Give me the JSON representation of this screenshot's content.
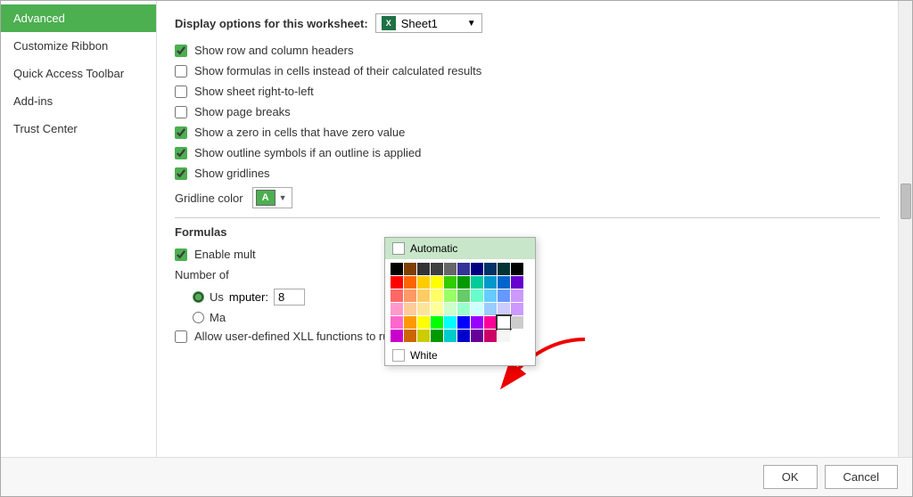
{
  "sidebar": {
    "items": [
      {
        "id": "advanced",
        "label": "Advanced",
        "active": true
      },
      {
        "id": "customize-ribbon",
        "label": "Customize Ribbon",
        "active": false
      },
      {
        "id": "quick-access-toolbar",
        "label": "Quick Access Toolbar",
        "active": false
      },
      {
        "id": "add-ins",
        "label": "Add-ins",
        "active": false
      },
      {
        "id": "trust-center",
        "label": "Trust Center",
        "active": false
      }
    ]
  },
  "main": {
    "display_section_label": "Display options for this worksheet:",
    "sheet_name": "Sheet1",
    "checkboxes": [
      {
        "id": "row-col-headers",
        "label": "Show row and column headers",
        "checked": true
      },
      {
        "id": "formulas-cells",
        "label": "Show formulas in cells instead of their calculated results",
        "checked": false
      },
      {
        "id": "sheet-right-to-left",
        "label": "Show sheet right-to-left",
        "checked": false
      },
      {
        "id": "page-breaks",
        "label": "Show page breaks",
        "checked": false
      },
      {
        "id": "zero-cells",
        "label": "Show a zero in cells that have zero value",
        "checked": true
      },
      {
        "id": "outline-symbols",
        "label": "Show outline symbols if an outline is applied",
        "checked": true
      },
      {
        "id": "gridlines",
        "label": "Show gridlines",
        "checked": true
      }
    ],
    "gridline_color_label": "Gridline color",
    "formulas": {
      "title": "Formulas",
      "enable_multi_label": "Enable mult",
      "enable_multi_checked": true,
      "number_of_label": "Number of",
      "radio_options": [
        {
          "id": "use-computer",
          "label": "Us",
          "detail": "mputer:",
          "value": "8",
          "selected": true
        },
        {
          "id": "manual",
          "label": "Ma",
          "selected": false
        }
      ],
      "allow_xll_label": "Allow user-defined XLL functions to run on a compute cluster",
      "allow_xll_checked": false
    }
  },
  "color_picker": {
    "automatic_label": "Automatic",
    "white_label": "White",
    "colors": [
      [
        "#000000",
        "#7f3f00",
        "#333333",
        "#3f3f3f",
        "#666666",
        "#333399",
        "#000080",
        "#003366",
        "#003333",
        "#000000"
      ],
      [
        "#ff0000",
        "#ff6600",
        "#ffcc00",
        "#ffff00",
        "#33cc00",
        "#009900",
        "#00cc99",
        "#0099cc",
        "#0066cc",
        "#6600cc"
      ],
      [
        "#ff6666",
        "#ff9966",
        "#ffcc66",
        "#ffff66",
        "#99ff66",
        "#66cc66",
        "#66ffcc",
        "#66ccff",
        "#6699ff",
        "#cc99ff"
      ],
      [
        "#ff99cc",
        "#ffcc99",
        "#ffe599",
        "#ffff99",
        "#ccffcc",
        "#99ffcc",
        "#ccffff",
        "#99ccff",
        "#99aaff",
        "#cc99ff"
      ],
      [
        "#ff66cc",
        "#ff9900",
        "#ffff00",
        "#00ff00",
        "#00ffff",
        "#0000ff",
        "#9900ff",
        "#ff0099",
        "#ffffff",
        "#cccccc"
      ],
      [
        "#cc00cc",
        "#cc6600",
        "#cccc00",
        "#009900",
        "#00cccc",
        "#0000cc",
        "#660099",
        "#cc0066",
        "#f5f5f5",
        "#ffffff"
      ]
    ],
    "selected_color": "#ffffff"
  },
  "buttons": {
    "ok_label": "OK",
    "cancel_label": "Cancel"
  }
}
